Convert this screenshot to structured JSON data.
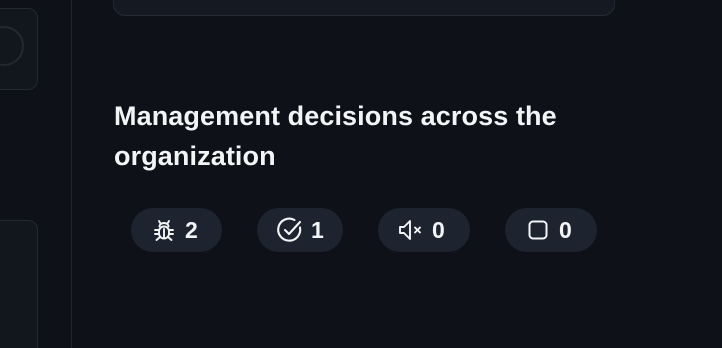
{
  "section": {
    "title": "Management decisions across the organization"
  },
  "badges": [
    {
      "icon": "bug-icon",
      "count": "2"
    },
    {
      "icon": "check-circle-icon",
      "count": "1"
    },
    {
      "icon": "speaker-muted-icon",
      "count": "0"
    },
    {
      "icon": "square-icon",
      "count": "0"
    }
  ],
  "colors": {
    "background": "#0e1117",
    "badge_background": "#1d2430",
    "text": "#f3f4f6"
  }
}
